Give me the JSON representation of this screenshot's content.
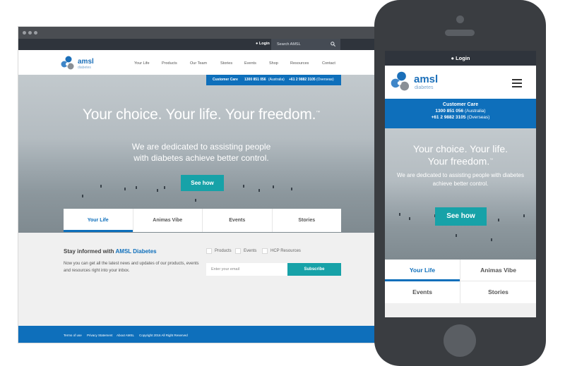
{
  "desktop": {
    "login": "Login",
    "search_placeholder": "Search AMSL",
    "logo": {
      "brand": "amsl",
      "sub": "diabetes"
    },
    "nav": [
      "Your Life",
      "Products",
      "Our Team",
      "Stories",
      "Events",
      "Shop",
      "Resources",
      "Contact"
    ],
    "customer_care": {
      "label": "Customer Care",
      "phone_au": "1300 851 056",
      "region_au": "(Australia)",
      "phone_os": "+61 2 9882 3105",
      "region_os": "(Overseas)"
    },
    "hero": {
      "headline": "Your choice. Your life. Your freedom.",
      "tm": "™",
      "sub_line1": "We are dedicated to assisting people",
      "sub_line2": "with diabetes achieve better control.",
      "cta": "See how"
    },
    "tabs": [
      {
        "label": "Your Life",
        "active": true
      },
      {
        "label": "Animas Vibe",
        "active": false
      },
      {
        "label": "Events",
        "active": false
      },
      {
        "label": "Stories",
        "active": false
      }
    ],
    "newsletter": {
      "heading_prefix": "Stay informed with",
      "heading_brand": "AMSL Diabetes",
      "desc": "Now you can get all the latest news and updates of our products, events and resources right into your inbox.",
      "checkboxes": [
        "Products",
        "Events",
        "HCP Resources"
      ],
      "email_placeholder": "Enter your email",
      "subscribe": "Subscribe"
    },
    "footer": [
      "Terms of use",
      "Privacy Statement",
      "About AMSL",
      "Copyright 2016 All Right Reserved"
    ]
  },
  "mobile": {
    "login": "Login",
    "logo": {
      "brand": "amsl",
      "sub": "diabetes"
    },
    "customer_care": {
      "label": "Customer Care",
      "phone_au": "1300 851 056",
      "region_au": "(Australia)",
      "phone_os": "+61 2 9882 3105",
      "region_os": "(Overseas)"
    },
    "hero": {
      "headline_line1": "Your choice. Your life.",
      "headline_line2": "Your freedom.",
      "tm": "™",
      "sub": "We are dedicated to assisting people with diabetes achieve better control.",
      "cta": "See how"
    },
    "tabs": [
      "Your Life",
      "Animas Vibe",
      "Events",
      "Stories"
    ]
  },
  "colors": {
    "brand_blue": "#0e6fbb",
    "teal": "#17a2a8",
    "dark_bar": "#2f343c"
  },
  "icons": [
    "user-icon",
    "search-icon",
    "menu-icon",
    "logo-circles-icon"
  ]
}
